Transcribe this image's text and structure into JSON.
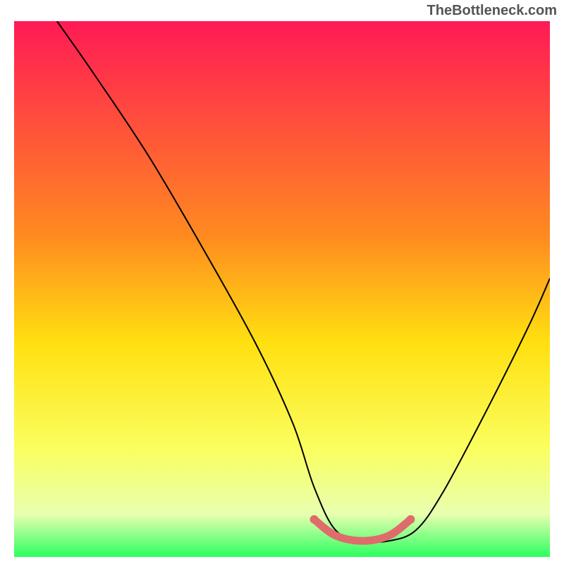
{
  "watermark": "TheBottleneck.com",
  "chart_data": {
    "type": "line",
    "title": "",
    "xlabel": "",
    "ylabel": "",
    "xlim": [
      0,
      100
    ],
    "ylim": [
      0,
      100
    ],
    "gradient_stops": [
      {
        "offset": 0,
        "color": "#ff1a55"
      },
      {
        "offset": 40,
        "color": "#ff8a20"
      },
      {
        "offset": 60,
        "color": "#ffe010"
      },
      {
        "offset": 80,
        "color": "#faff60"
      },
      {
        "offset": 92,
        "color": "#e8ffb0"
      },
      {
        "offset": 100,
        "color": "#2bff60"
      }
    ],
    "series": [
      {
        "name": "bottleneck-curve",
        "color": "#000000",
        "x": [
          8,
          15,
          25,
          35,
          45,
          52,
          56,
          60,
          65,
          70,
          75,
          80,
          88,
          96,
          100
        ],
        "y": [
          100,
          90,
          75,
          58,
          40,
          25,
          13,
          5,
          3,
          3,
          5,
          12,
          27,
          43,
          52
        ]
      }
    ],
    "highlight": {
      "name": "optimal-range",
      "color": "#e06b6b",
      "x": [
        56,
        60,
        65,
        70,
        74
      ],
      "y": [
        7,
        4,
        3,
        4,
        7
      ]
    }
  }
}
